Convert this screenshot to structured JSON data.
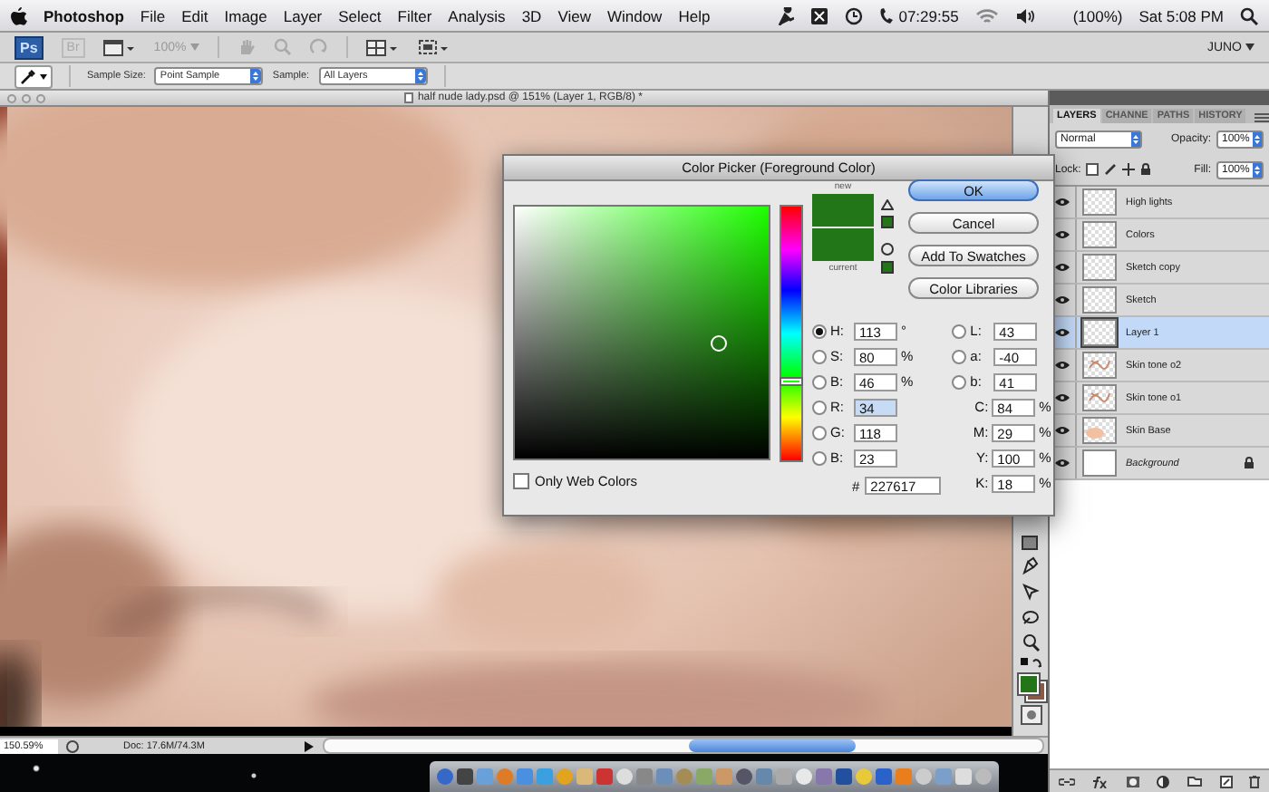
{
  "menu_bar": {
    "app_name": "Photoshop",
    "menus": [
      "File",
      "Edit",
      "Image",
      "Layer",
      "Select",
      "Filter",
      "Analysis",
      "3D",
      "View",
      "Window",
      "Help"
    ],
    "clock": "07:29:55",
    "battery": "(100%)",
    "datetime": "Sat 5:08 PM"
  },
  "app_bar": {
    "logo": "Ps",
    "bridge": "Br",
    "zoom": "100%",
    "workspace": "JUNO"
  },
  "options_bar": {
    "sample_size": {
      "label": "Sample Size:",
      "value": "Point Sample"
    },
    "sample": {
      "label": "Sample:",
      "value": "All Layers"
    }
  },
  "document": {
    "title": "half nude lady.psd @ 151% (Layer 1, RGB/8) *",
    "zoom": "150.59%",
    "doc_size": "Doc: 17.6M/74.3M"
  },
  "color_picker": {
    "title": "Color Picker (Foreground Color)",
    "new_label": "new",
    "current_label": "current",
    "hue": {
      "level": 0.31
    },
    "buttons": [
      {
        "label": "OK",
        "default": true
      },
      {
        "label": "Cancel",
        "default": false
      },
      {
        "label": "Add To Swatches",
        "default": false
      },
      {
        "label": "Color Libraries",
        "default": false
      }
    ],
    "left_fields": [
      {
        "label": "H:",
        "value": "113",
        "unit": "°",
        "selected": true,
        "focused": false
      },
      {
        "label": "S:",
        "value": "80",
        "unit": "%",
        "selected": false,
        "focused": false
      },
      {
        "label": "B:",
        "value": "46",
        "unit": "%",
        "selected": false,
        "focused": false
      },
      {
        "label": "R:",
        "value": "34",
        "selected": false,
        "focused": true
      },
      {
        "label": "G:",
        "value": "118",
        "selected": false,
        "focused": false
      },
      {
        "label": "B:",
        "value": "23",
        "selected": false,
        "focused": false
      }
    ],
    "right_fields": [
      {
        "kind": "radio",
        "label": "L:",
        "value": "43",
        "selected": false
      },
      {
        "kind": "radio",
        "label": "a:",
        "value": "-40",
        "selected": false
      },
      {
        "kind": "radio",
        "label": "b:",
        "value": "41",
        "selected": false
      },
      {
        "kind": "plain",
        "label": "C:",
        "value": "84",
        "unit": "%"
      },
      {
        "kind": "plain",
        "label": "M:",
        "value": "29",
        "unit": "%"
      },
      {
        "kind": "plain",
        "label": "Y:",
        "value": "100",
        "unit": "%"
      },
      {
        "kind": "plain",
        "label": "K:",
        "value": "18",
        "unit": "%"
      }
    ],
    "hex": {
      "label": "#",
      "value": "227617"
    },
    "only_web_colors": {
      "label": "Only Web Colors",
      "checked": false
    }
  },
  "layers_panel": {
    "tabs": [
      {
        "label": "LAYERS",
        "selected": true
      },
      {
        "label": "CHANNE",
        "selected": false
      },
      {
        "label": "PATHS",
        "selected": false
      },
      {
        "label": "HISTORY",
        "selected": false
      }
    ],
    "blend_mode": "Normal",
    "opacity": {
      "label": "Opacity:",
      "value": "100%"
    },
    "lock_label": "Lock:",
    "fill": {
      "label": "Fill:",
      "value": "100%"
    },
    "layers": [
      {
        "name": "High lights",
        "kind": "transparent",
        "visible": true,
        "selected": false,
        "locked": false
      },
      {
        "name": "Colors",
        "kind": "transparent",
        "visible": true,
        "selected": false,
        "locked": false
      },
      {
        "name": "Sketch copy",
        "kind": "transparent",
        "visible": true,
        "selected": false,
        "locked": false
      },
      {
        "name": "Sketch",
        "kind": "transparent",
        "visible": true,
        "selected": false,
        "locked": false
      },
      {
        "name": "Layer 1",
        "kind": "transparent",
        "visible": true,
        "selected": true,
        "locked": false
      },
      {
        "name": "Skin tone o2",
        "kind": "strokes",
        "visible": true,
        "selected": false,
        "locked": false
      },
      {
        "name": "Skin tone o1",
        "kind": "strokes",
        "visible": true,
        "selected": false,
        "locked": false
      },
      {
        "name": "Skin Base",
        "kind": "fill",
        "visible": true,
        "selected": false,
        "locked": false
      },
      {
        "name": "Background",
        "kind": "background",
        "visible": true,
        "selected": false,
        "locked": true
      }
    ]
  }
}
